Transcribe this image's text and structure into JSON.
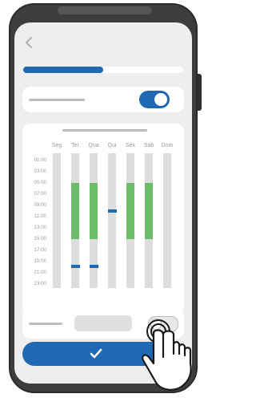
{
  "schedule": {
    "days": [
      "Seg",
      "Ter",
      "Qua",
      "Qui",
      "Sex",
      "Sáb",
      "Dom"
    ],
    "times": [
      "01:00",
      "03:00",
      "05:00",
      "07:00",
      "09:00",
      "11:00",
      "13:00",
      "15:00",
      "17:00",
      "19:00",
      "21:00",
      "23:00"
    ]
  },
  "progress": {
    "fraction": 0.5
  },
  "toggles": {
    "first_enabled": true,
    "second_enabled": false
  },
  "colors": {
    "primary": "#1f69b3",
    "active_slot": "#6cbd6a",
    "slot_bg": "#dddddd"
  },
  "icons": {
    "back": "chevron-left-icon",
    "confirm": "check-icon",
    "tap": "hand-pointer-icon"
  }
}
